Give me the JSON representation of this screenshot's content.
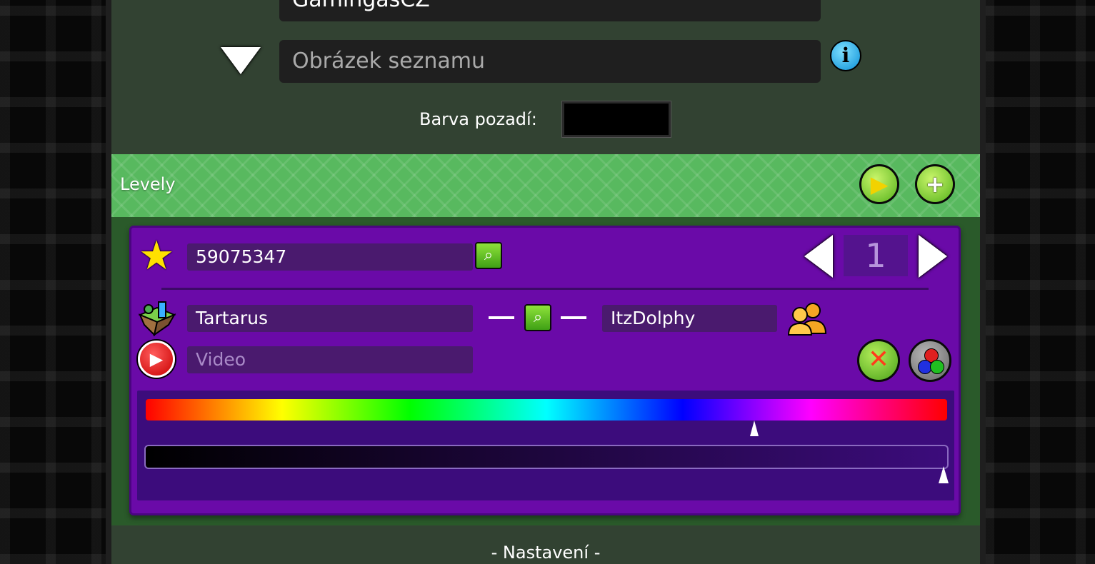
{
  "list": {
    "author_name": "GamingasCZ",
    "image_placeholder": "Obrázek seznamu",
    "background_label": "Barva pozadí:",
    "background_color": "#000000"
  },
  "levels": {
    "title": "Levely",
    "level": {
      "id": "59075347",
      "position": "1",
      "name": "Tartarus",
      "creator": "ItzDolphy",
      "video_placeholder": "Video",
      "hue_percent": 0.78,
      "lightness_percent": 1.0
    }
  },
  "settings": {
    "title": "- Nastavení -"
  },
  "colors": {
    "panel_bg": "#324232",
    "levels_header": "#58b95f",
    "card_bg": "#6a0aa8",
    "accent_green": "#55b21c"
  },
  "icons": {
    "info": "i",
    "search": "⌕",
    "play": "▶",
    "add": "+",
    "delete": "✕",
    "star": "★"
  }
}
